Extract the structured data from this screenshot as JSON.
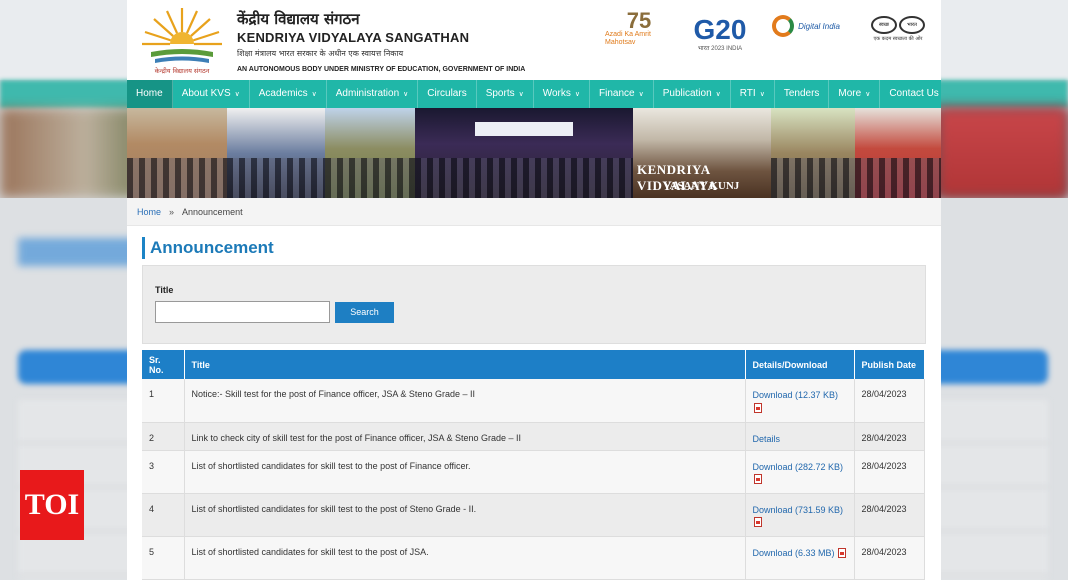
{
  "header": {
    "hindi_name": "केंद्रीय विद्यालय संगठन",
    "org_name": "KENDRIYA VIDYALAYA SANGATHAN",
    "hindi_subtitle": "शिक्षा मंत्रालय भारत सरकार के अधीन एक स्वायत्त निकाय",
    "subtitle": "AN AUTONOMOUS BODY UNDER MINISTRY OF EDUCATION, GOVERNMENT OF INDIA",
    "logo_caption": "केन्द्रीय विद्यालय संगठन",
    "partners": {
      "azadi_num": "75",
      "azadi_text": "Azadi Ka Amrit Mahotsav",
      "g20_mark": "G20",
      "g20_sub": "भारत 2023 INDIA",
      "digital_india": "Digital India",
      "swachh_left": "स्वच्छ",
      "swachh_right": "भारत",
      "swachh_tag": "एक कदम स्वच्छता की ओर"
    }
  },
  "nav": [
    {
      "label": "Home",
      "caret": false,
      "active": true
    },
    {
      "label": "About KVS",
      "caret": true
    },
    {
      "label": "Academics",
      "caret": true
    },
    {
      "label": "Administration",
      "caret": true
    },
    {
      "label": "Circulars",
      "caret": false
    },
    {
      "label": "Sports",
      "caret": true
    },
    {
      "label": "Works",
      "caret": true
    },
    {
      "label": "Finance",
      "caret": true
    },
    {
      "label": "Publication",
      "caret": true
    },
    {
      "label": "RTI",
      "caret": true
    },
    {
      "label": "Tenders",
      "caret": false
    },
    {
      "label": "More",
      "caret": true
    },
    {
      "label": "Contact Us",
      "caret": false
    }
  ],
  "banner": {
    "sign_line1": "KENDRIYA VIDYALAYA",
    "sign_line2": "VASANT KUNJ"
  },
  "breadcrumb": {
    "home": "Home",
    "separator": "»",
    "current": "Announcement"
  },
  "page_title": "Announcement",
  "filter": {
    "label": "Title",
    "value": "",
    "placeholder": "",
    "button": "Search"
  },
  "table": {
    "headers": [
      "Sr. No.",
      "Title",
      "Details/Download",
      "Publish Date"
    ],
    "rows": [
      {
        "sr": "1",
        "title": "Notice:- Skill test for the post of Finance officer, JSA & Steno Grade – II",
        "link": "Download (12.37 KB)",
        "pdf": true,
        "date": "28/04/2023"
      },
      {
        "sr": "2",
        "title": "Link to check city of skill test for the post of Finance officer, JSA & Steno Grade – II",
        "link": "Details",
        "pdf": false,
        "date": "28/04/2023"
      },
      {
        "sr": "3",
        "title": "List of shortlisted candidates for skill test to the post of Finance officer.",
        "link": "Download (282.72 KB)",
        "pdf": true,
        "date": "28/04/2023"
      },
      {
        "sr": "4",
        "title": "List of shortlisted candidates for skill test to the post of Steno Grade - II.",
        "link": "Download (731.59 KB)",
        "pdf": true,
        "date": "28/04/2023"
      },
      {
        "sr": "5",
        "title": "List of shortlisted candidates for skill test to the post of JSA.",
        "link": "Download (6.33 MB)",
        "pdf": true,
        "date": "28/04/2023"
      }
    ]
  },
  "watermark": "TOI"
}
